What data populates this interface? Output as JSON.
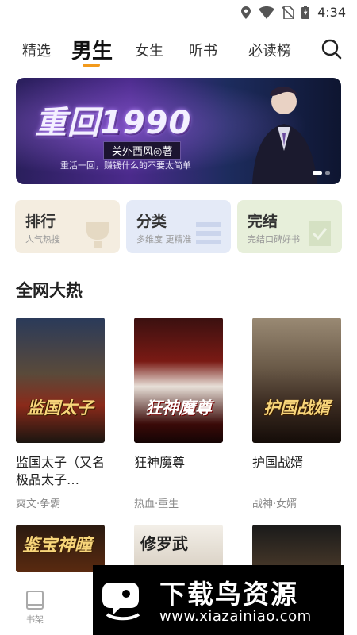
{
  "status_bar": {
    "time": "4:34",
    "icons": [
      "location-icon",
      "wifi-icon",
      "no-sim-icon",
      "battery-charging-icon"
    ]
  },
  "tabs": [
    {
      "label": "精选",
      "active": false
    },
    {
      "label": "男生",
      "active": true
    },
    {
      "label": "女生",
      "active": false
    },
    {
      "label": "听书",
      "active": false
    },
    {
      "label": "必读榜",
      "active": false
    }
  ],
  "banner": {
    "title": "重回1990",
    "author": "关外西风◎著",
    "tagline": "重活一回，赚钱什么的不要太简单"
  },
  "categories": [
    {
      "name": "排行",
      "sub": "人气热搜",
      "color": "#f3ecdf"
    },
    {
      "name": "分类",
      "sub": "多维度 更精准",
      "color": "#e3e9f6"
    },
    {
      "name": "完结",
      "sub": "完结口碑好书",
      "color": "#e6efd9"
    }
  ],
  "section": {
    "title": "全网大热"
  },
  "books": [
    {
      "title": "监国太子（又名极品太子…",
      "tags": "爽文·争霸",
      "cover_text": "监国太子"
    },
    {
      "title": "狂神魔尊",
      "tags": "热血·重生",
      "cover_text": "狂神魔尊"
    },
    {
      "title": "护国战婿",
      "tags": "战神·女婿",
      "cover_text": "护国战婿"
    }
  ],
  "books_row2": [
    {
      "cover_text": "鉴宝神瞳"
    },
    {
      "cover_text": "修罗武"
    },
    {
      "cover_text": ""
    }
  ],
  "bottom_nav": {
    "shelf_label": "书架"
  },
  "watermark": {
    "title": "下载鸟资源",
    "url": "www.xiazainiao.com"
  }
}
